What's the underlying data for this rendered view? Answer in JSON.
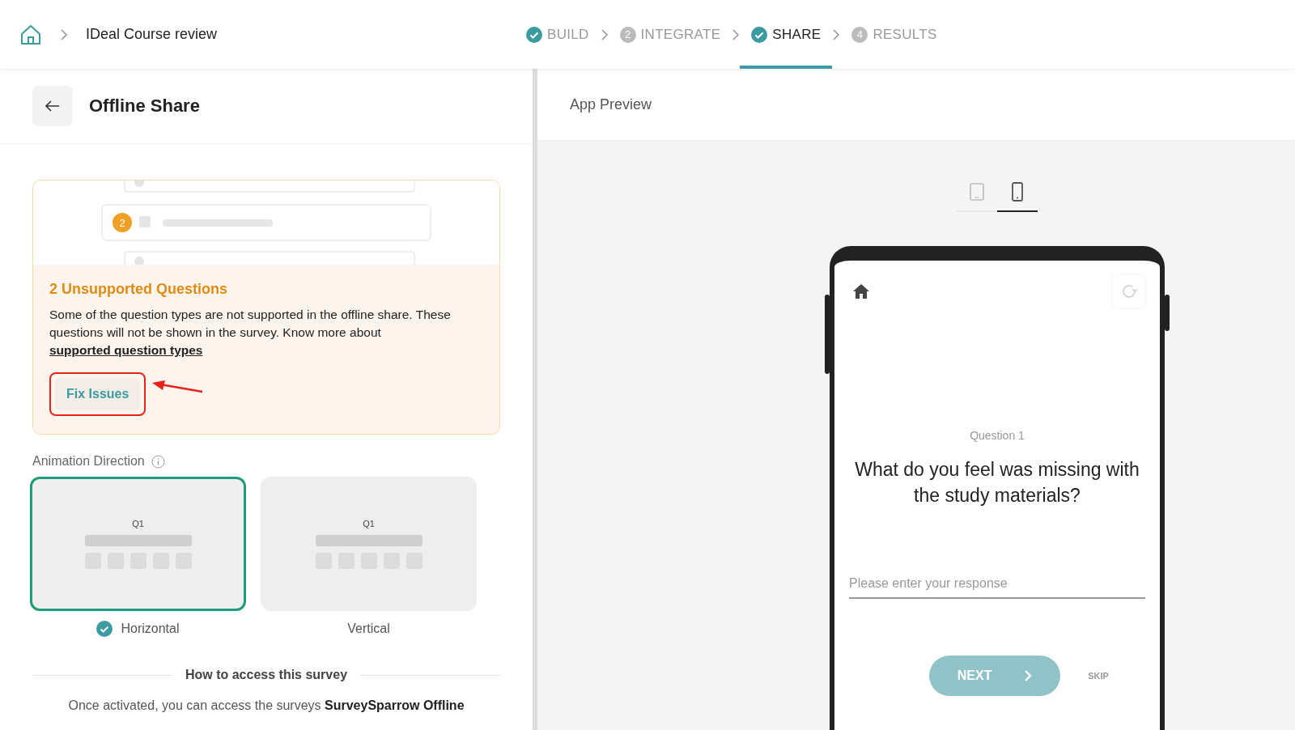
{
  "breadcrumb": {
    "title": "IDeal Course review"
  },
  "steps": [
    {
      "label": "BUILD",
      "kind": "done",
      "selected": false
    },
    {
      "label": "INTEGRATE",
      "kind": "number",
      "number": "2",
      "selected": false
    },
    {
      "label": "SHARE",
      "kind": "done",
      "selected": true
    },
    {
      "label": "RESULTS",
      "kind": "number",
      "number": "4",
      "selected": false
    }
  ],
  "left_panel": {
    "title": "Offline Share",
    "warning": {
      "badge": "2",
      "title": "2 Unsupported Questions",
      "text": "Some of the question types are not supported in the offline share. These questions will not be shown in the survey. Know more about",
      "link": "supported question types",
      "button": "Fix Issues"
    },
    "animation_direction": {
      "label": "Animation Direction",
      "options": [
        {
          "label": "Horizontal",
          "preview": "Q1",
          "selected": true
        },
        {
          "label": "Vertical",
          "preview": "Q1",
          "selected": false
        }
      ]
    },
    "access": {
      "heading": "How to access this survey",
      "text": "Once activated, you can access the surveys **SurveySparrow Offline**"
    }
  },
  "preview": {
    "title": "App Preview",
    "devices": [
      {
        "kind": "tablet",
        "selected": false
      },
      {
        "kind": "phone",
        "selected": true
      }
    ],
    "question_label": "Question 1",
    "question": "What do you feel was missing with the study materials?",
    "placeholder": "Please enter your response",
    "next": "NEXT",
    "skip": "SKIP"
  }
}
